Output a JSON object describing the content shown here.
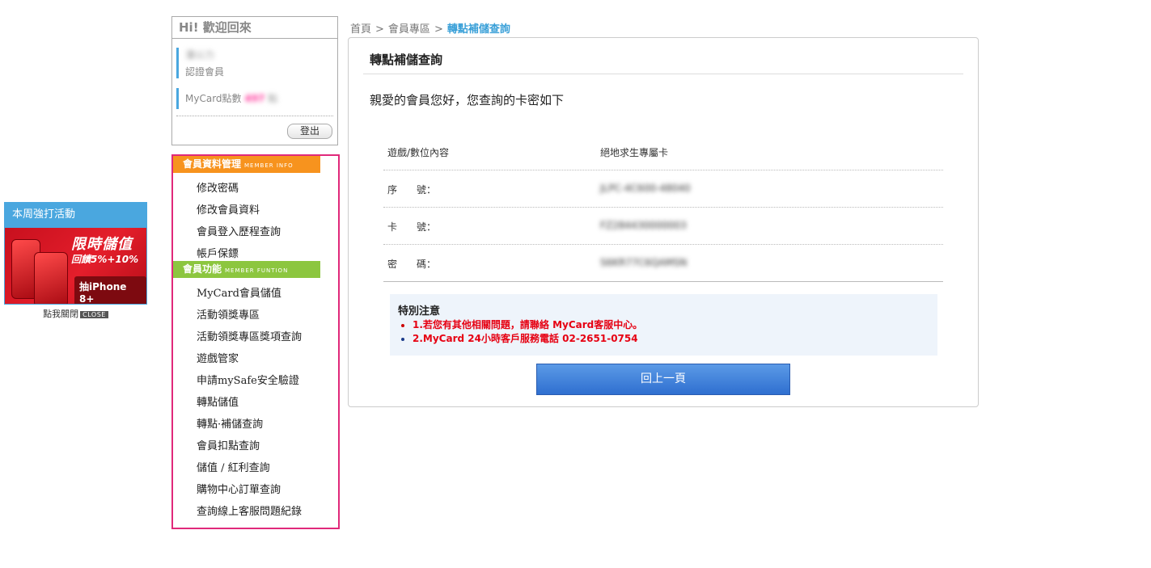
{
  "promo": {
    "title": "本周強打活動",
    "headline": "限時儲值",
    "subline": "回饋5%+10%",
    "prize": "抽iPhone 8+",
    "close_text": "點我關閉",
    "close_tag": "CLOSE"
  },
  "user": {
    "greeting": "Hi! 歡迎回來",
    "name": "潘以力",
    "member_type": "認證會員",
    "points_label": "MyCard點數",
    "points_value": "497",
    "points_unit": "點",
    "logout_label": "登出"
  },
  "menu": {
    "section1": {
      "label": "會員資料管理",
      "en": "MEMBER INFO"
    },
    "section1_items": [
      "修改密碼",
      "修改會員資料",
      "會員登入歷程查詢",
      "帳戶保鏢"
    ],
    "section2": {
      "label": "會員功能",
      "en": "MEMBER FUNTION"
    },
    "section2_items": [
      "MyCard會員儲值",
      "活動領獎專區",
      "活動領獎專區獎項查詢",
      "遊戲管家",
      "申請mySafe安全驗證",
      "轉點儲值",
      "轉點·補儲查詢",
      "會員扣點查詢",
      "儲值 / 紅利查詢",
      "購物中心訂單查詢",
      "查詢線上客服問題紀錄"
    ]
  },
  "breadcrumb": {
    "home": "首頁",
    "sep": ">",
    "member": "會員專區",
    "current": "轉點補儲查詢"
  },
  "panel": {
    "title": "轉點補儲查詢",
    "greeting": "親愛的會員您好，您查詢的卡密如下",
    "rows": [
      {
        "label": "遊戲/數位內容",
        "value": "絕地求生專屬卡"
      },
      {
        "label": "序　　號：",
        "value": "JLPC-4C600-48040"
      },
      {
        "label": "卡　　號：",
        "value": "FZ284430000003"
      },
      {
        "label": "密　　碼：",
        "value": "S6KR77C6QAMSN"
      }
    ],
    "notice_title": "特別注意",
    "notice_items": [
      "1.若您有其他相關問題，請聯絡 MyCard客服中心。",
      "2.MyCard 24小時客戶服務電話 02-2651-0754"
    ],
    "back_label": "回上一頁"
  },
  "colors": {
    "accent_blue": "#4aa7df",
    "menu_border": "#e0297a",
    "menu_orange": "#f7931e",
    "menu_green": "#8cc63f",
    "alert_red": "#e60012"
  }
}
